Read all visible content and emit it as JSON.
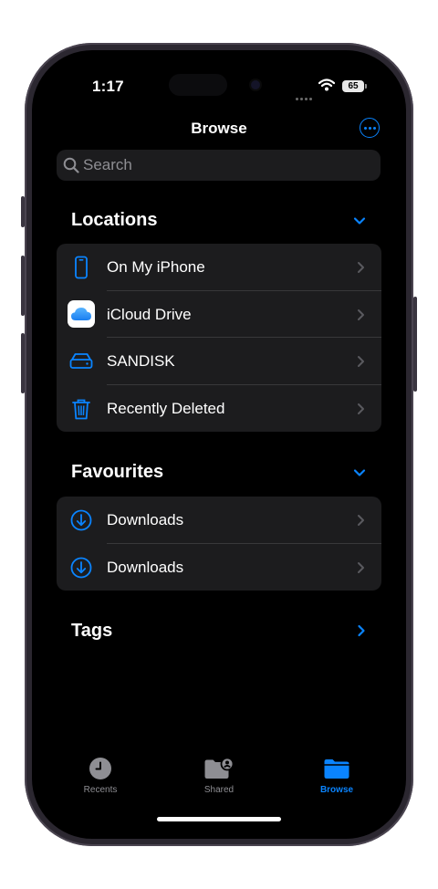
{
  "status_bar": {
    "time": "1:17",
    "battery": "65"
  },
  "nav": {
    "title": "Browse"
  },
  "search": {
    "placeholder": "Search"
  },
  "locations": {
    "header": "Locations",
    "items": [
      {
        "label": "On My iPhone",
        "icon": "iphone-icon"
      },
      {
        "label": "iCloud Drive",
        "icon": "icloud-icon"
      },
      {
        "label": "SANDISK",
        "icon": "external-drive-icon"
      },
      {
        "label": "Recently Deleted",
        "icon": "trash-icon"
      }
    ]
  },
  "favourites": {
    "header": "Favourites",
    "items": [
      {
        "label": "Downloads",
        "icon": "download-icon"
      },
      {
        "label": "Downloads",
        "icon": "download-icon"
      }
    ]
  },
  "tags": {
    "header": "Tags"
  },
  "tabbar": {
    "tabs": [
      {
        "label": "Recents",
        "icon": "clock-icon",
        "active": false
      },
      {
        "label": "Shared",
        "icon": "shared-folder-icon",
        "active": false
      },
      {
        "label": "Browse",
        "icon": "folder-icon",
        "active": true
      }
    ]
  },
  "colors": {
    "accent": "#0a84ff",
    "background": "#000000",
    "card": "#1c1c1e",
    "separator": "#38383a",
    "secondary_text": "#8e8e93"
  }
}
